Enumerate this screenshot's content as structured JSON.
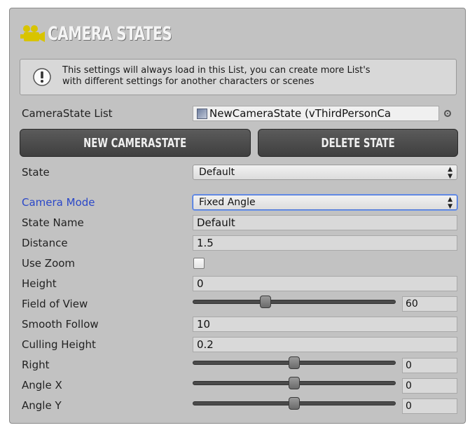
{
  "header": {
    "title": "CAMERA STATES",
    "icon": "camera-icon"
  },
  "help": {
    "icon": "info-icon",
    "text_line1": "This settings will always load in this List, you can create more List's",
    "text_line2": "with different settings for another characters or scenes"
  },
  "camera_state_list": {
    "label": "CameraState List",
    "value": "NewCameraState (vThirdPersonCa"
  },
  "buttons": {
    "new_state": "NEW CAMERASTATE",
    "delete_state": "DELETE STATE"
  },
  "state": {
    "label": "State",
    "value": "Default"
  },
  "camera_mode": {
    "label": "Camera Mode",
    "value": "Fixed Angle"
  },
  "state_name": {
    "label": "State Name",
    "value": "Default"
  },
  "distance": {
    "label": "Distance",
    "value": "1.5"
  },
  "use_zoom": {
    "label": "Use Zoom",
    "checked": false
  },
  "height": {
    "label": "Height",
    "value": "0"
  },
  "field_of_view": {
    "label": "Field of View",
    "value": "60",
    "level": 0.35
  },
  "smooth_follow": {
    "label": "Smooth Follow",
    "value": "10"
  },
  "culling_height": {
    "label": "Culling Height",
    "value": "0.2"
  },
  "right": {
    "label": "Right",
    "value": "0",
    "level": 0.5
  },
  "angle_x": {
    "label": "Angle X",
    "value": "0",
    "level": 0.5
  },
  "angle_y": {
    "label": "Angle Y",
    "value": "0",
    "level": 0.5
  },
  "colors": {
    "accent_label": "#2a47c8",
    "button_bg": "#4a4a4a",
    "icon_yellow": "#d8c400"
  }
}
